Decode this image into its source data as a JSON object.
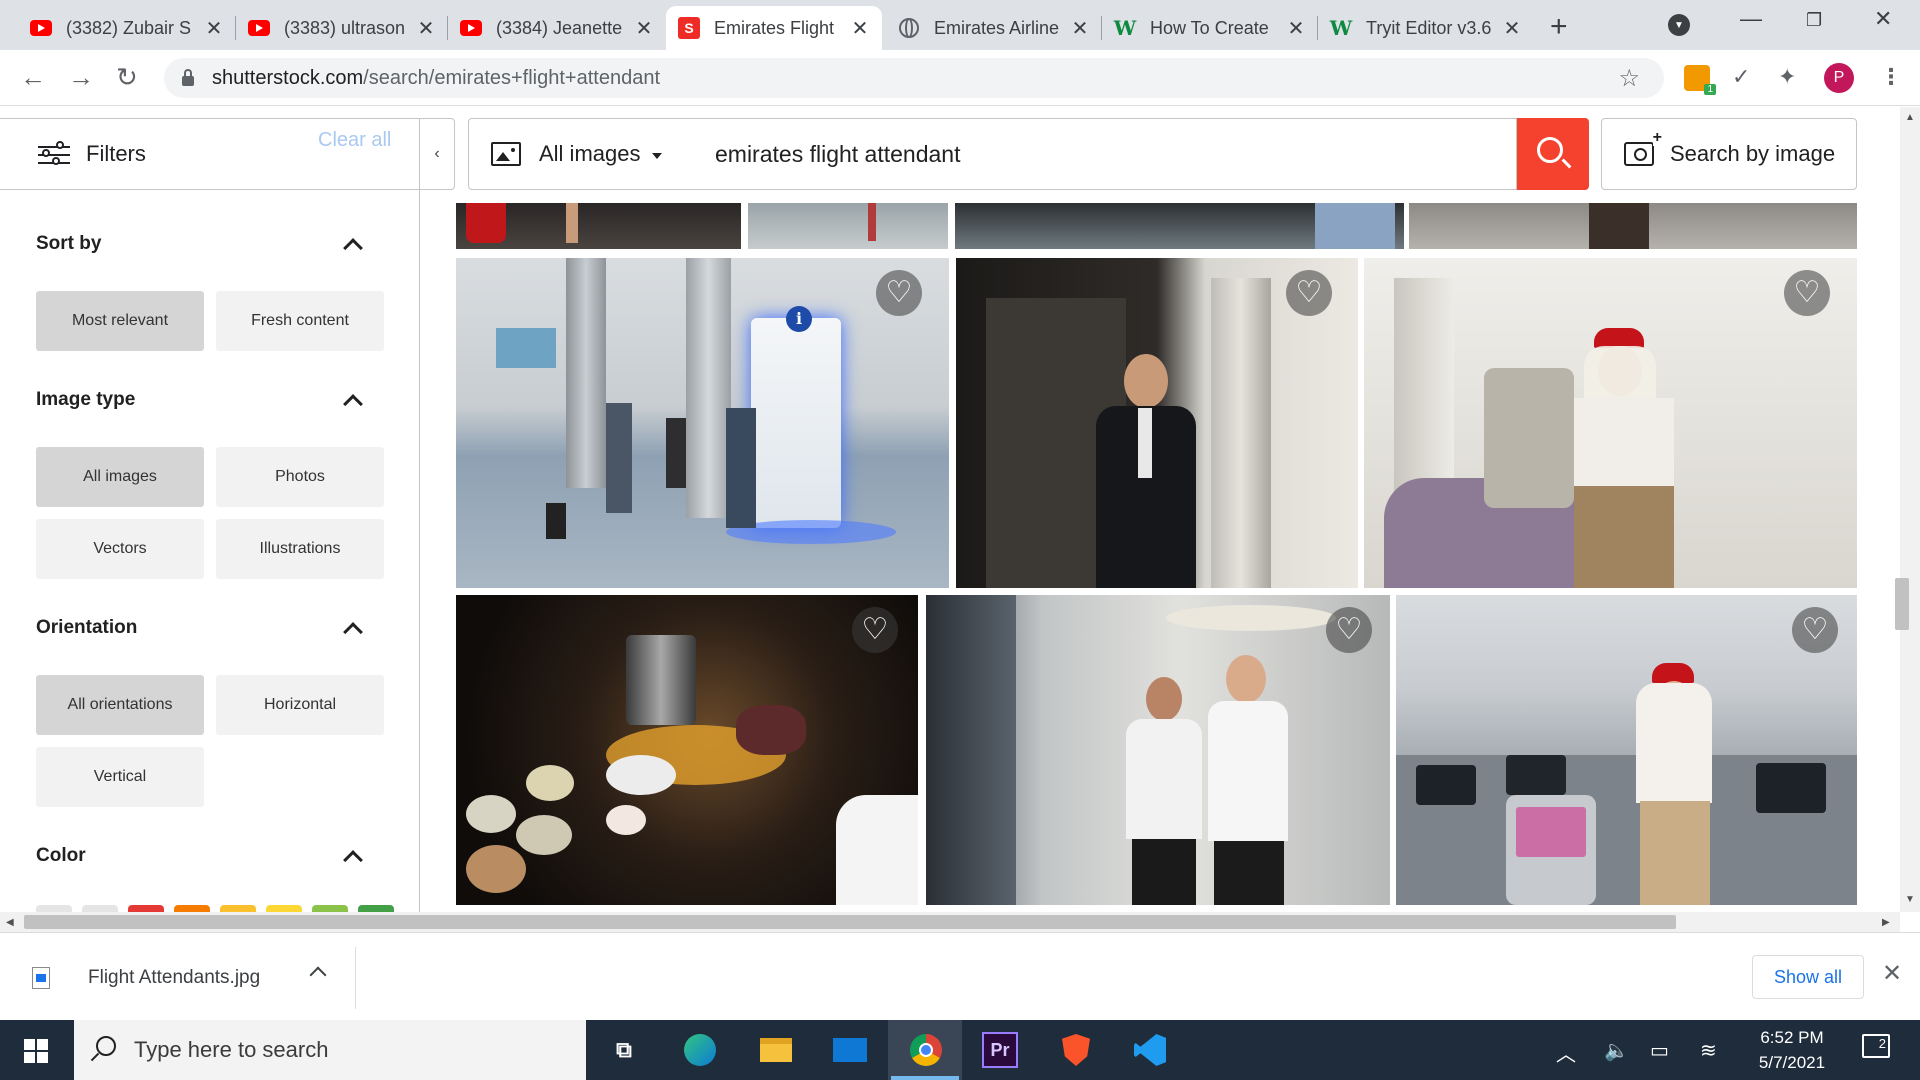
{
  "browser": {
    "tabs": [
      {
        "title": "(3382) Zubair S",
        "icon": "youtube-icon"
      },
      {
        "title": "(3383) ultrason",
        "icon": "youtube-icon"
      },
      {
        "title": "(3384) Jeanette",
        "icon": "youtube-icon"
      },
      {
        "title": "Emirates Flight",
        "icon": "shutterstock-icon",
        "active": true
      },
      {
        "title": "Emirates Airline",
        "icon": "globe-icon"
      },
      {
        "title": "How To Create",
        "icon": "wix-icon"
      },
      {
        "title": "Tryit Editor v3.6",
        "icon": "wix-icon"
      }
    ],
    "close_glyph": "✕",
    "url_host": "shutterstock.com",
    "url_path": "/search/emirates+flight+attendant",
    "profile_initial": "P",
    "ext_badge": "1"
  },
  "filters": {
    "title": "Filters",
    "clear_all": "Clear all",
    "collapse_glyph": "‹",
    "sections": {
      "sort_by": {
        "label": "Sort by",
        "options": [
          "Most relevant",
          "Fresh content"
        ],
        "selected": "Most relevant"
      },
      "image_type": {
        "label": "Image type",
        "options": [
          "All images",
          "Photos",
          "Vectors",
          "Illustrations"
        ],
        "selected": "All images"
      },
      "orientation": {
        "label": "Orientation",
        "options": [
          "All orientations",
          "Horizontal",
          "Vertical"
        ],
        "selected": "All orientations"
      },
      "color": {
        "label": "Color"
      }
    },
    "color_swatches": [
      "#e5e5e5",
      "#e5e5e5",
      "#e53935",
      "#f57c00",
      "#fbc02d",
      "#fdd835",
      "#8bc34a",
      "#43a047"
    ]
  },
  "search": {
    "type_label": "All images",
    "query": "emirates flight attendant",
    "search_by_image": "Search by image",
    "accent": "#f5422e"
  },
  "downloads": {
    "file_name": "Flight Attendants.jpg",
    "show_all": "Show all"
  },
  "taskbar": {
    "search_placeholder": "Type here to search",
    "time": "6:52 PM",
    "date": "5/7/2021",
    "notifications": "2"
  }
}
